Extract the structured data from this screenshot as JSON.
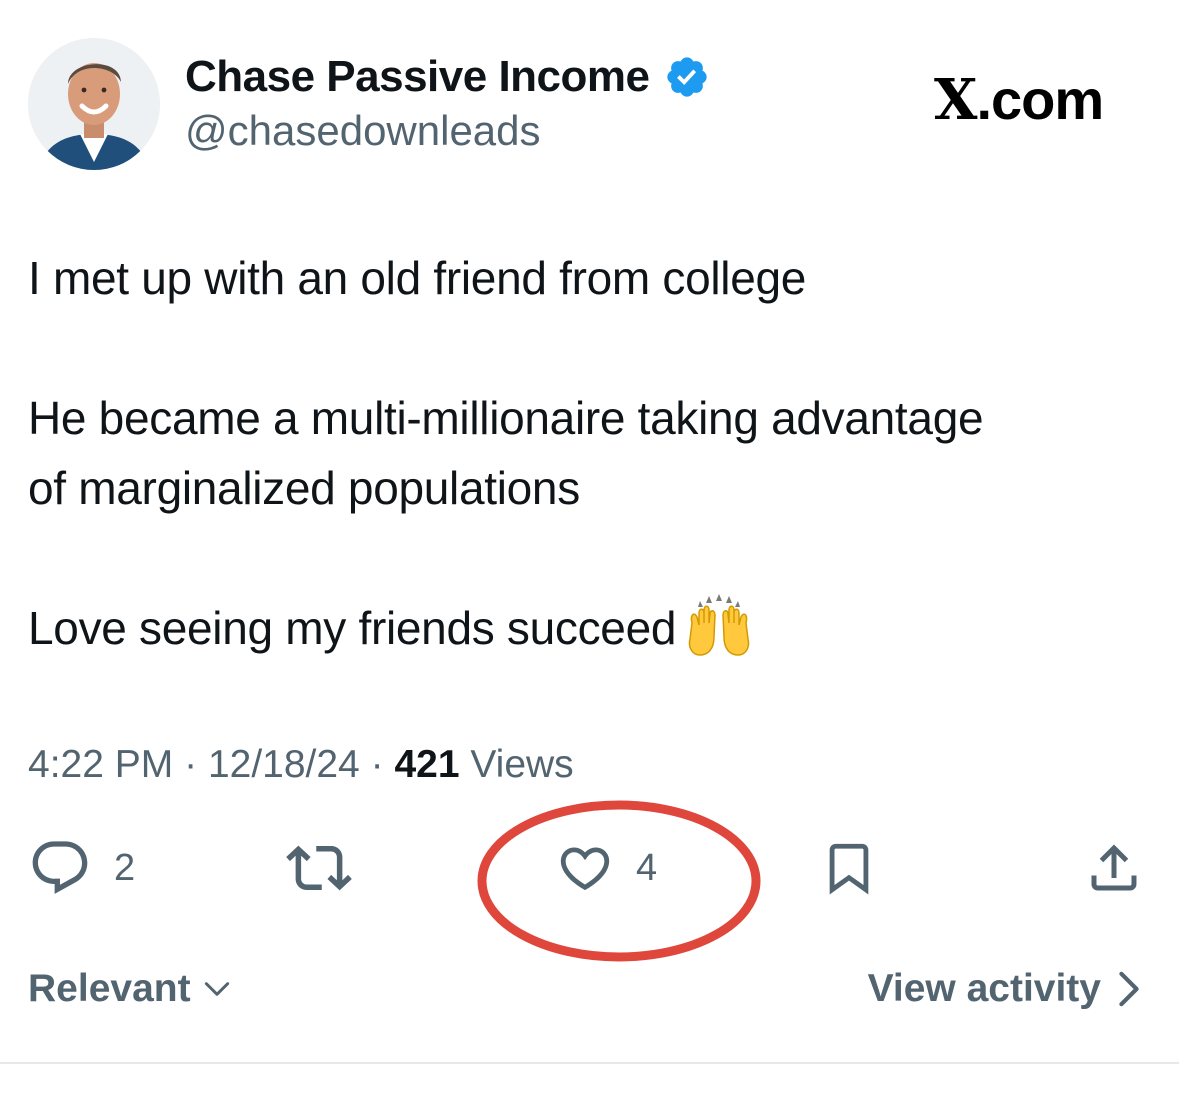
{
  "author": {
    "display_name": "Chase Passive Income",
    "handle": "@chasedownleads",
    "verified": true,
    "verified_color": "#1d9bf0"
  },
  "brand": {
    "prefix": "X",
    "suffix": ".com"
  },
  "tweet": {
    "paragraphs": [
      "I met up with an old friend from college",
      "He became a multi-millionaire taking advantage",
      "of marginalized populations",
      "Love seeing my friends succeed"
    ],
    "emoji": "raising-hands-emoji"
  },
  "meta": {
    "time": "4:22 PM",
    "separator": "·",
    "date": "12/18/24",
    "views_count": "421",
    "views_label": "Views"
  },
  "actions": {
    "reply_count": "2",
    "like_count": "4",
    "icons": [
      "reply-icon",
      "repost-icon",
      "like-icon",
      "bookmark-icon",
      "share-icon"
    ]
  },
  "annotation": {
    "highlight_color": "#e0473c"
  },
  "footer": {
    "sort_label": "Relevant",
    "view_activity_label": "View activity"
  },
  "colors": {
    "text_primary": "#0f1419",
    "text_secondary": "#536471",
    "divider": "#e6e9eb"
  }
}
